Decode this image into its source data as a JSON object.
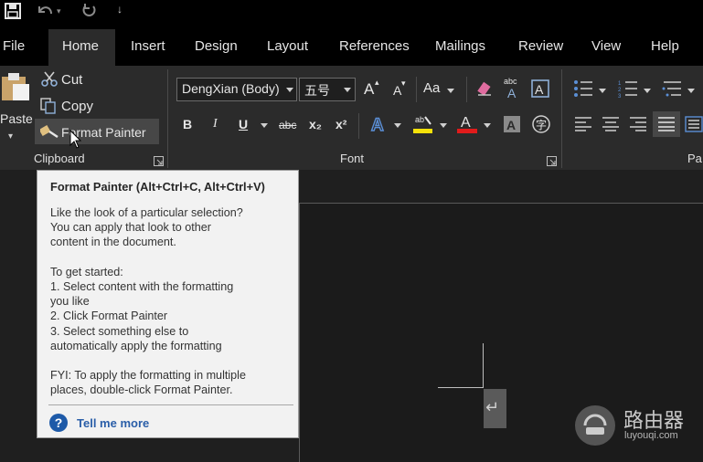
{
  "quick_access": {
    "save_icon": "save-icon",
    "undo_icon": "undo-icon",
    "redo_icon": "redo-icon",
    "customize": "↓"
  },
  "tabs": [
    "File",
    "Home",
    "Insert",
    "Design",
    "Layout",
    "References",
    "Mailings",
    "Review",
    "View",
    "Help"
  ],
  "clipboard": {
    "paste": "Paste",
    "cut": "Cut",
    "copy": "Copy",
    "format_painter": "Format Painter",
    "group_label": "Clipboard"
  },
  "font": {
    "font_name": "DengXian (Body)",
    "font_size": "五号",
    "group_label": "Font",
    "bold": "B",
    "italic": "I",
    "underline": "U",
    "strikethrough": "abc",
    "subscript": "x₂",
    "superscript": "x²",
    "change_case": "Aa",
    "grow": "A",
    "shrink": "A"
  },
  "paragraph": {
    "group_label": "Pa"
  },
  "tooltip": {
    "title": "Format Painter (Alt+Ctrl+C, Alt+Ctrl+V)",
    "lines": [
      "Like the look of a particular selection?",
      "You can apply that look to other",
      "content in the document.",
      "",
      "To get started:",
      "1. Select content with the formatting",
      "you like",
      "2. Click Format Painter",
      "3. Select something else to",
      "automatically apply the formatting",
      "",
      "FYI: To apply the formatting in multiple",
      "places, double-click Format Painter."
    ],
    "help_link": "Tell me more"
  },
  "watermark": {
    "title": "路由器",
    "url": "luyouqi.com"
  },
  "colors": {
    "accent_blue": "#2a5ea8",
    "highlight_yellow": "#f5e10a",
    "font_red": "#e11b1b"
  }
}
